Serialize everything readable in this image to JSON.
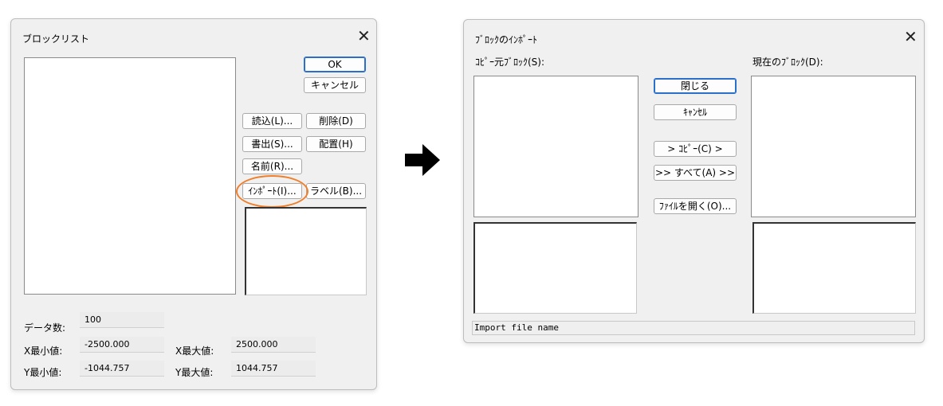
{
  "block_list": {
    "title": "ブロックリスト",
    "ok_label": "OK",
    "cancel_label": "キャンセル",
    "load_label": "読込(L)...",
    "delete_label": "削除(D)",
    "write_label": "書出(S)...",
    "place_label": "配置(H)",
    "name_label": "名前(R)...",
    "import_label": "ｲﾝﾎﾟｰﾄ(I)...",
    "label_label": "ラベル(B)...",
    "data_count_label": "データ数:",
    "data_count_value": "100",
    "x_min_label": "X最小値:",
    "x_min_value": "-2500.000",
    "x_max_label": "X最大値:",
    "x_max_value": "2500.000",
    "y_min_label": "Y最小値:",
    "y_min_value": "-1044.757",
    "y_max_label": "Y最大値:",
    "y_max_value": "1044.757"
  },
  "block_import": {
    "title": "ﾌﾞﾛｯｸのｲﾝﾎﾟｰﾄ",
    "source_label": "ｺﾋﾟｰ元ﾌﾞﾛｯｸ(S):",
    "current_label": "現在のﾌﾞﾛｯｸ(D):",
    "close_label": "閉じる",
    "cancel_label": "ｷｬﾝｾﾙ",
    "copy_label": "> ｺﾋﾟｰ(C) >",
    "all_label": ">> すべて(A) >>",
    "open_file_label": "ﾌｧｲﾙを開く(O)...",
    "status_text": "Import file name"
  },
  "icons": {
    "close": "close-icon",
    "arrow": "arrow-right-icon"
  },
  "colors": {
    "highlight": "#f07f2a",
    "default_button_border": "#2a6fc9"
  }
}
